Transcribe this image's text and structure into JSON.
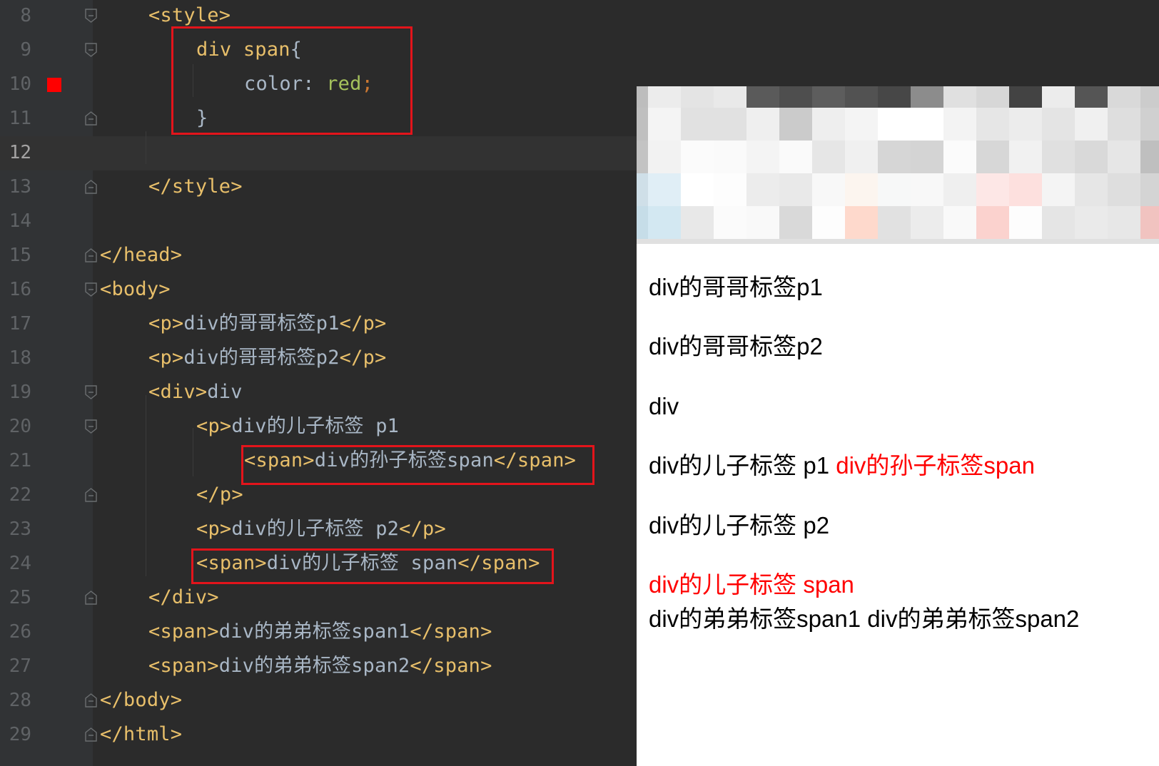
{
  "editor": {
    "current_line": "12",
    "lines": [
      {
        "num": "8",
        "parts": [
          {
            "t": "<style>",
            "c": "tag"
          }
        ]
      },
      {
        "num": "9",
        "parts": [
          {
            "t": "div span",
            "c": "sel"
          },
          {
            "t": "{",
            "c": "brace"
          }
        ]
      },
      {
        "num": "10",
        "parts": [
          {
            "t": "color",
            "c": "prop"
          },
          {
            "t": ": ",
            "c": "prop"
          },
          {
            "t": "red",
            "c": "val"
          },
          {
            "t": ";",
            "c": "punc"
          }
        ]
      },
      {
        "num": "11",
        "parts": [
          {
            "t": "}",
            "c": "brace"
          }
        ]
      },
      {
        "num": "12",
        "parts": []
      },
      {
        "num": "13",
        "parts": [
          {
            "t": "</style>",
            "c": "tag"
          }
        ]
      },
      {
        "num": "14",
        "parts": []
      },
      {
        "num": "15",
        "parts": [
          {
            "t": "</head>",
            "c": "tag"
          }
        ]
      },
      {
        "num": "16",
        "parts": [
          {
            "t": "<body>",
            "c": "tag"
          }
        ]
      },
      {
        "num": "17",
        "parts": [
          {
            "t": "<p>",
            "c": "tag"
          },
          {
            "t": "div的哥哥标签p1",
            "c": "txt"
          },
          {
            "t": "</p>",
            "c": "tag"
          }
        ]
      },
      {
        "num": "18",
        "parts": [
          {
            "t": "<p>",
            "c": "tag"
          },
          {
            "t": "div的哥哥标签p2",
            "c": "txt"
          },
          {
            "t": "</p>",
            "c": "tag"
          }
        ]
      },
      {
        "num": "19",
        "parts": [
          {
            "t": "<div>",
            "c": "tag"
          },
          {
            "t": "div",
            "c": "txt"
          }
        ]
      },
      {
        "num": "20",
        "parts": [
          {
            "t": "<p>",
            "c": "tag"
          },
          {
            "t": "div的儿子标签 p1",
            "c": "txt"
          }
        ]
      },
      {
        "num": "21",
        "parts": [
          {
            "t": "<span>",
            "c": "tag"
          },
          {
            "t": "div的孙子标签span",
            "c": "txt"
          },
          {
            "t": "</span>",
            "c": "tag"
          }
        ]
      },
      {
        "num": "22",
        "parts": [
          {
            "t": "</p>",
            "c": "tag"
          }
        ]
      },
      {
        "num": "23",
        "parts": [
          {
            "t": "<p>",
            "c": "tag"
          },
          {
            "t": "div的儿子标签 p2",
            "c": "txt"
          },
          {
            "t": "</p>",
            "c": "tag"
          }
        ]
      },
      {
        "num": "24",
        "parts": [
          {
            "t": "<span>",
            "c": "tag"
          },
          {
            "t": "div的儿子标签 span",
            "c": "txt"
          },
          {
            "t": "</span>",
            "c": "tag"
          }
        ]
      },
      {
        "num": "25",
        "parts": [
          {
            "t": "</div>",
            "c": "tag"
          }
        ]
      },
      {
        "num": "26",
        "parts": [
          {
            "t": "<span>",
            "c": "tag"
          },
          {
            "t": "div的弟弟标签span1",
            "c": "txt"
          },
          {
            "t": "</span>",
            "c": "tag"
          }
        ]
      },
      {
        "num": "27",
        "parts": [
          {
            "t": "<span>",
            "c": "tag"
          },
          {
            "t": "div的弟弟标签span2",
            "c": "txt"
          },
          {
            "t": "</span>",
            "c": "tag"
          }
        ]
      },
      {
        "num": "28",
        "parts": [
          {
            "t": "</body>",
            "c": "tag"
          }
        ]
      },
      {
        "num": "29",
        "parts": [
          {
            "t": "</html>",
            "c": "tag"
          }
        ]
      }
    ]
  },
  "preview": {
    "p1": "div的哥哥标签p1",
    "p2": "div的哥哥标签p2",
    "div_text": "div",
    "child_p1": "div的儿子标签 p1",
    "grandchild_span": "div的孙子标签span",
    "child_p2": "div的儿子标签 p2",
    "child_span": "div的儿子标签 span",
    "sibling_span1": "div的弟弟标签span1",
    "sibling_span2": "div的弟弟标签span2"
  },
  "colors": {
    "editor_bg": "#2b2b2b",
    "tag": "#e8bf6a",
    "text": "#a9b7c6",
    "value": "#a5c25c",
    "punctuation": "#cc7832",
    "highlight_box": "#e3141b",
    "breakpoint": "#ff0000",
    "rendered_red": "#ff0000"
  }
}
